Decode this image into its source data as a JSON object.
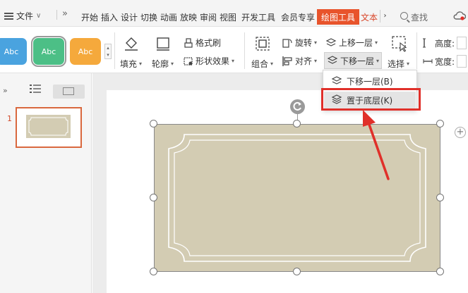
{
  "menubar": {
    "file_label": "文件",
    "more_label": "»",
    "tabs": [
      {
        "label": "开始"
      },
      {
        "label": "插入"
      },
      {
        "label": "设计"
      },
      {
        "label": "切换"
      },
      {
        "label": "动画"
      },
      {
        "label": "放映"
      },
      {
        "label": "审阅"
      },
      {
        "label": "视图"
      },
      {
        "label": "开发工具"
      },
      {
        "label": "会员专享"
      },
      {
        "label": "绘图工具"
      },
      {
        "label": "文本"
      }
    ],
    "active_tab": "绘图工具",
    "search_label": "查找",
    "accent_color": "#e8542c"
  },
  "ribbon": {
    "styles": [
      {
        "label": "Abc",
        "color": "#4aa3df"
      },
      {
        "label": "Abc",
        "color": "#4cbf86"
      },
      {
        "label": "Abc",
        "color": "#f5a93c"
      }
    ],
    "fill_label": "填充",
    "outline_label": "轮廓",
    "format_painter_label": "格式刷",
    "shape_effects_label": "形状效果",
    "group_label": "组合",
    "rotate_label": "旋转",
    "align_label": "对齐",
    "bring_forward_label": "上移一层",
    "send_backward_label": "下移一层",
    "select_label": "选择",
    "height_label": "高度:",
    "width_label": "宽度:"
  },
  "dropdown": {
    "items": [
      {
        "label": "下移一层(B)",
        "icon": "send-backward-icon"
      },
      {
        "label": "置于底层(K)",
        "icon": "send-to-back-icon"
      }
    ],
    "highlight_color": "#e0302a"
  },
  "slides_panel": {
    "slide_number": "1"
  },
  "shape": {
    "fill_color": "#d3ccb3",
    "border_color": "#ffffff"
  }
}
